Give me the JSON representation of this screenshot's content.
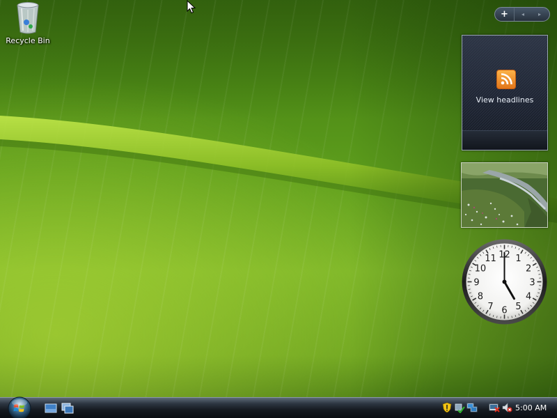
{
  "desktop": {
    "icons": [
      {
        "label": "Recycle Bin",
        "icon": "recycle-bin-icon"
      }
    ],
    "wallpaper": {
      "description_colors": {
        "leaf": "#6aa220",
        "midrib": "#9fcf2e"
      }
    }
  },
  "sidebar": {
    "controls": {
      "add_label": "+",
      "prev_icon": "◂",
      "next_icon": "▸"
    },
    "feed_gadget": {
      "headline_text": "View headlines",
      "icon": "rss-icon",
      "accent": "#f39a2e"
    },
    "slideshow_gadget": {
      "icon": "landscape-photo"
    },
    "clock_gadget": {
      "numbers": [
        "12",
        "1",
        "2",
        "3",
        "4",
        "5",
        "6",
        "7",
        "8",
        "9",
        "10",
        "11"
      ],
      "time": "5:00"
    }
  },
  "taskbar": {
    "start_icon": "windows-orb-icon",
    "quick_launch": [
      {
        "icon": "show-desktop-icon"
      },
      {
        "icon": "switch-windows-icon"
      }
    ],
    "tray": {
      "icons": [
        "security-shield-icon",
        "safely-remove-icon",
        "network-icon",
        "volume-muted-icon"
      ],
      "time": "5:00 AM"
    }
  }
}
